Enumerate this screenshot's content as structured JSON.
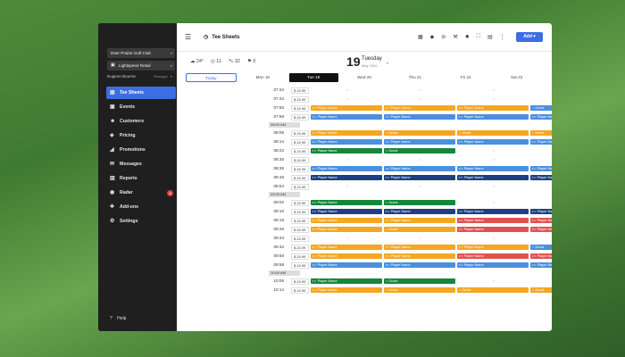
{
  "sidebar": {
    "club": "Deer Prairie Golf Club",
    "location": "Lightspeed Retail",
    "user": "Eugene Bourne",
    "role": "Manager",
    "items": [
      {
        "label": "Tee Sheets",
        "icon": "grid-icon",
        "active": true
      },
      {
        "label": "Events",
        "icon": "calendar-icon"
      },
      {
        "label": "Customers",
        "icon": "people-icon"
      },
      {
        "label": "Pricing",
        "icon": "tag-icon"
      },
      {
        "label": "Promotions",
        "icon": "megaphone-icon"
      },
      {
        "label": "Messages",
        "icon": "envelope-icon"
      },
      {
        "label": "Reports",
        "icon": "chart-icon"
      },
      {
        "label": "Radar",
        "icon": "radar-icon",
        "badge": "3"
      },
      {
        "label": "Add-ons",
        "icon": "puzzle-icon"
      },
      {
        "label": "Settings",
        "icon": "gear-icon"
      }
    ],
    "help": "Help"
  },
  "topbar": {
    "title": "Tee Sheets",
    "add_label": "Add ▾"
  },
  "weather": {
    "temp": "24°",
    "wind": "11",
    "carts": "32",
    "walkers": "0"
  },
  "date": {
    "day": "19",
    "weekday": "Tuesday",
    "month_year": "May 2020"
  },
  "days": [
    "Today",
    "Mon 18",
    "Tue 19",
    "Wed 20",
    "Thu 21",
    "Fri 22",
    "Sat 23"
  ],
  "sections": [
    "06:00 AM",
    "09:00 AM",
    "10:00 AM"
  ],
  "colors": {
    "orange": "#f5a623",
    "blue": "#4a8fe0",
    "navy": "#1e3f86",
    "green": "#16873a",
    "red": "#e05252",
    "accent": "#3d6de3"
  },
  "slot_text": {
    "player": "Player Name",
    "guest": "Guest"
  },
  "rows": [
    {
      "time": "07:34",
      "price": "$ 24.99",
      "slots": [
        "e",
        "e",
        "e",
        "e"
      ]
    },
    {
      "time": "07:42",
      "price": "$ 24.99",
      "slots": [
        "e",
        "e",
        "e",
        "e"
      ]
    },
    {
      "time": "07:50",
      "price": "$ 24.99",
      "slots": [
        "o:p",
        "o:p",
        "o:p",
        "b:g"
      ]
    },
    {
      "time": "07:58",
      "price": "$ 24.99",
      "slots": [
        "b:p",
        "b:p",
        "b:p",
        "b:p"
      ]
    },
    {
      "section": "06:00 AM"
    },
    {
      "time": "08:06",
      "price": "$ 24.99",
      "slots": [
        "o:p",
        "o:g",
        "o:g",
        "o:g"
      ]
    },
    {
      "time": "08:14",
      "price": "$ 24.99",
      "slots": [
        "b:p",
        "b:p",
        "b:p",
        "b:p"
      ]
    },
    {
      "time": "08:22",
      "price": "$ 24.99",
      "slots": [
        "g:p",
        "g:g",
        "e",
        "e"
      ]
    },
    {
      "time": "08:30",
      "price": "$ 24.99",
      "slots": [
        "e",
        "e",
        "e",
        "e"
      ]
    },
    {
      "time": "08:38",
      "price": "$ 24.99",
      "slots": [
        "b:p",
        "b:p",
        "b:p",
        "b:p"
      ]
    },
    {
      "time": "08:46",
      "price": "$ 24.99",
      "slots": [
        "n:p",
        "n:p",
        "n:p",
        "n:p"
      ]
    },
    {
      "time": "08:54",
      "price": "$ 24.99",
      "slots": [
        "e",
        "e",
        "e",
        "e"
      ]
    },
    {
      "section": "09:00 AM"
    },
    {
      "time": "09:02",
      "price": "$ 24.99",
      "slots": [
        "g:p",
        "g:g",
        "e",
        "e"
      ]
    },
    {
      "time": "09:10",
      "price": "$ 24.99",
      "slots": [
        "n:p",
        "n:p",
        "n:p",
        "n:p"
      ]
    },
    {
      "time": "09:18",
      "price": "$ 24.99",
      "slots": [
        "o:p",
        "o:p",
        "r:p",
        "r:p"
      ]
    },
    {
      "time": "09:26",
      "price": "$ 24.99",
      "slots": [
        "o:p",
        "o:g",
        "r:p",
        "r:p"
      ]
    },
    {
      "time": "09:34",
      "price": "$ 24.99",
      "slots": [
        "e",
        "e",
        "e",
        "e"
      ]
    },
    {
      "time": "09:42",
      "price": "$ 24.99",
      "slots": [
        "o:p",
        "o:p",
        "o:p",
        "b:g"
      ]
    },
    {
      "time": "09:50",
      "price": "$ 24.99",
      "slots": [
        "o:p",
        "o:p",
        "r:p",
        "r:p"
      ]
    },
    {
      "time": "09:58",
      "price": "$ 24.99",
      "slots": [
        "b:p",
        "b:p",
        "b:p",
        "b:p"
      ]
    },
    {
      "section": "10:00 AM"
    },
    {
      "time": "10:06",
      "price": "$ 24.99",
      "slots": [
        "g:p",
        "g:g",
        "e",
        "e"
      ]
    },
    {
      "time": "10:14",
      "price": "$ 24.99",
      "slots": [
        "o:p",
        "o:g",
        "o:g",
        "o:g"
      ]
    }
  ]
}
